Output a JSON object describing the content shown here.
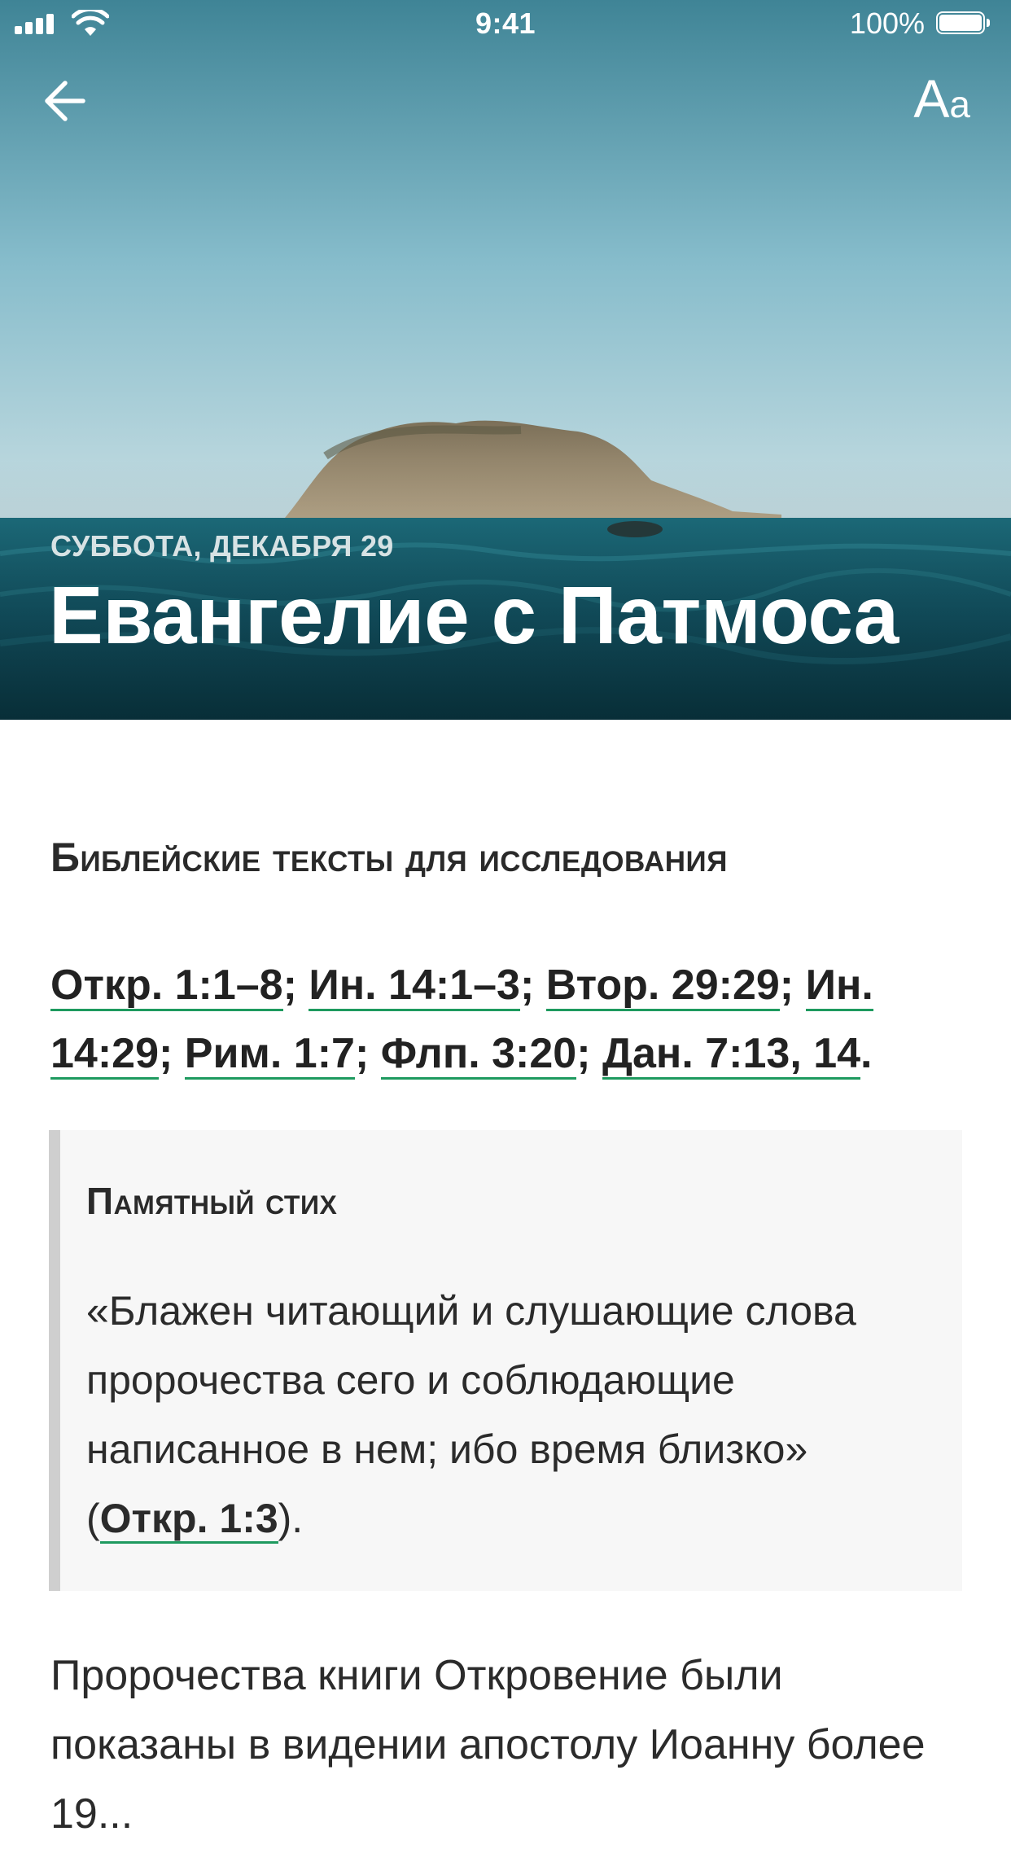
{
  "status_bar": {
    "time": "9:41",
    "battery": "100%"
  },
  "header": {
    "back_icon": "arrow-left-icon",
    "font_size_icon": "font-size-icon",
    "font_big": "A",
    "font_small": "a",
    "date": "СУББОТА, ДЕКАБРЯ 29",
    "title": "Евангелие с Патмоса"
  },
  "study": {
    "heading": "Библейские тексты для исследования",
    "references": [
      "Откр. 1:1–8",
      "Ин. 14:1–3",
      "Втор. 29:29",
      "Ин. 14:29",
      "Рим. 1:7",
      "Флп. 3:20",
      "Дан. 7:13, 14"
    ],
    "separator": "; ",
    "end": "."
  },
  "memory_verse": {
    "title": "Памятный стих",
    "text": "«Блажен читающий и слушающие слова пророчества сего и соблюдающие написанное в нем; ибо время близко» (",
    "reference": "Откр. 1:3",
    "tail": ")."
  },
  "body": {
    "paragraph": "Пророчества книги Откровение были показаны в видении апостолу Иоанну более 19..."
  }
}
